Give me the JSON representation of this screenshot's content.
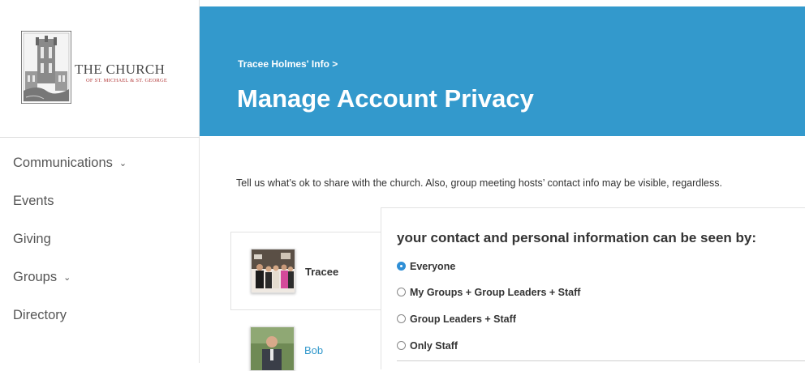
{
  "logo": {
    "title": "THE CHURCH",
    "subtitle": "OF ST. MICHAEL & ST. GEORGE"
  },
  "nav": {
    "items": [
      {
        "label": "Communications",
        "has_dropdown": true
      },
      {
        "label": "Events",
        "has_dropdown": false
      },
      {
        "label": "Giving",
        "has_dropdown": false
      },
      {
        "label": "Groups",
        "has_dropdown": true
      },
      {
        "label": "Directory",
        "has_dropdown": false
      }
    ],
    "chevron": "⌄"
  },
  "header": {
    "breadcrumb": "Tracee Holmes' Info >",
    "title": "Manage Account Privacy",
    "background_color": "#3399cc"
  },
  "intro_text": "Tell us what’s ok to share with the church. Also, group meeting hosts’ contact info may be visible, regardless.",
  "members": [
    {
      "name": "Tracee",
      "selected": true
    },
    {
      "name": "Bob",
      "selected": false
    }
  ],
  "privacy": {
    "heading": "your contact and personal information can be seen by:",
    "options": [
      {
        "label": "Everyone",
        "checked": true
      },
      {
        "label": "My Groups + Group Leaders + Staff",
        "checked": false
      },
      {
        "label": "Group Leaders + Staff",
        "checked": false
      },
      {
        "label": "Only Staff",
        "checked": false
      }
    ]
  }
}
